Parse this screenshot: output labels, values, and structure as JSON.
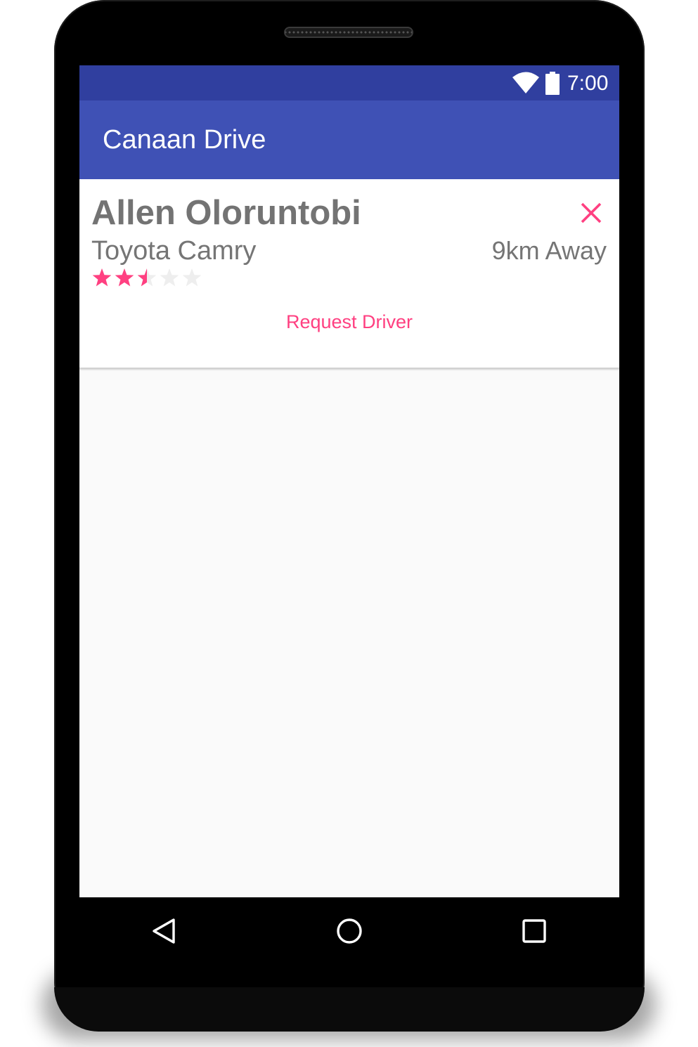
{
  "status_bar": {
    "time": "7:00",
    "wifi_icon": "wifi-icon",
    "battery_icon": "battery-icon"
  },
  "app_bar": {
    "title": "Canaan Drive"
  },
  "driver_card": {
    "name": "Allen Oloruntobi",
    "car": "Toyota Camry",
    "distance": "9km Away",
    "rating": 2.5,
    "rating_max": 5,
    "close_icon": "close-icon",
    "request_label": "Request Driver",
    "accent_color": "#ff4081"
  },
  "nav_bar": {
    "back_icon": "back-icon",
    "home_icon": "home-icon",
    "recents_icon": "recents-icon"
  },
  "colors": {
    "primary": "#3f51b5",
    "primary_dark": "#303f9f",
    "accent": "#ff4081",
    "background": "#fafafa"
  }
}
